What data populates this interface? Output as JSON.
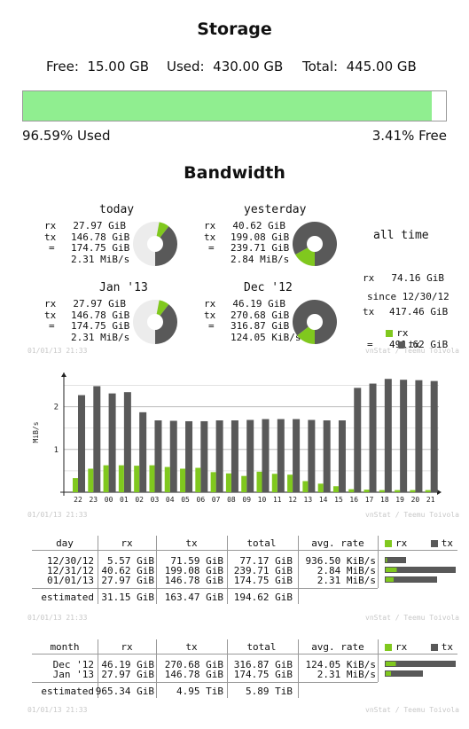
{
  "storage": {
    "title": "Storage",
    "free_label": "Free:",
    "free_value": "15.00 GB",
    "used_label": "Used:",
    "used_value": "430.00 GB",
    "total_label": "Total:",
    "total_value": "445.00 GB",
    "used_percent_text": "96.59% Used",
    "free_percent_text": "3.41% Free",
    "used_fraction": 0.9659
  },
  "bandwidth": {
    "title": "Bandwidth",
    "colors": {
      "rx": "#80c81e",
      "tx": "#595959",
      "bg": "#ececec"
    },
    "summaries": [
      {
        "title": "today",
        "rx": "27.97 GiB",
        "tx": "146.78 GiB",
        "total": "174.75 GiB",
        "rate": "2.31 MiB/s",
        "rx_frac": 0.0753,
        "tx_frac": 0.395
      },
      {
        "title": "yesterday",
        "rx": "40.62 GiB",
        "tx": "199.08 GiB",
        "total": "239.71 GiB",
        "rate": "2.84 MiB/s",
        "rx_frac": 0.17,
        "tx_frac": 0.83
      },
      {
        "title": "Jan '13",
        "rx": "27.97 GiB",
        "tx": "146.78 GiB",
        "total": "174.75 GiB",
        "rate": "2.31 MiB/s",
        "rx_frac": 0.0753,
        "tx_frac": 0.395
      },
      {
        "title": "Dec '12",
        "rx": "46.19 GiB",
        "tx": "270.68 GiB",
        "total": "316.87 GiB",
        "rate": "124.05 KiB/s",
        "rx_frac": 0.146,
        "tx_frac": 0.854
      }
    ],
    "labels": {
      "rx": "rx",
      "tx": "tx",
      "eq": "="
    },
    "all_time": {
      "title": "all time",
      "rx": "74.16 GiB",
      "tx": "417.46 GiB",
      "total": "491.62 GiB",
      "since": "since 12/30/12"
    },
    "stamp": "01/01/13 21:33",
    "credit": "vnStat / Teemu Toivola",
    "chart_data": {
      "type": "bar",
      "ylabel": "MiB/s",
      "ylim": [
        0,
        2.8
      ],
      "yticks": [
        "1",
        "2"
      ],
      "categories": [
        "22",
        "23",
        "00",
        "01",
        "02",
        "03",
        "04",
        "05",
        "06",
        "07",
        "08",
        "09",
        "10",
        "11",
        "12",
        "13",
        "14",
        "15",
        "16",
        "17",
        "18",
        "19",
        "20",
        "21"
      ],
      "series": [
        {
          "name": "tx",
          "values": [
            2.27,
            2.48,
            2.31,
            2.34,
            1.87,
            1.68,
            1.67,
            1.66,
            1.66,
            1.68,
            1.68,
            1.69,
            1.71,
            1.71,
            1.71,
            1.69,
            1.68,
            1.68,
            2.44,
            2.54,
            2.65,
            2.63,
            2.62,
            2.6
          ]
        },
        {
          "name": "rx",
          "values": [
            0.33,
            0.55,
            0.63,
            0.63,
            0.62,
            0.63,
            0.59,
            0.55,
            0.57,
            0.47,
            0.44,
            0.38,
            0.48,
            0.43,
            0.41,
            0.26,
            0.2,
            0.14,
            0.07,
            0.06,
            0.05,
            0.05,
            0.05,
            0.05
          ]
        }
      ]
    },
    "daily_table": {
      "headers": [
        "day",
        "rx",
        "tx",
        "total",
        "avg. rate"
      ],
      "rows": [
        {
          "label": "12/30/12",
          "rx": "5.57 GiB",
          "tx": "71.59 GiB",
          "total": "77.17 GiB",
          "rate": "936.50 KiB/s",
          "rx_frac": 0.022,
          "tx_frac": 0.28
        },
        {
          "label": "12/31/12",
          "rx": "40.62 GiB",
          "tx": "199.08 GiB",
          "total": "239.71 GiB",
          "rate": "2.84 MiB/s",
          "rx_frac": 0.16,
          "tx_frac": 0.84
        },
        {
          "label": "01/01/13",
          "rx": "27.97 GiB",
          "tx": "146.78 GiB",
          "total": "174.75 GiB",
          "rate": "2.31 MiB/s",
          "rx_frac": 0.12,
          "tx_frac": 0.62
        }
      ],
      "estimated": {
        "label": "estimated",
        "rx": "31.15 GiB",
        "tx": "163.47 GiB",
        "total": "194.62 GiB"
      }
    },
    "monthly_table": {
      "headers": [
        "month",
        "rx",
        "tx",
        "total",
        "avg. rate"
      ],
      "rows": [
        {
          "label": "Dec '12",
          "rx": "46.19 GiB",
          "tx": "270.68 GiB",
          "total": "316.87 GiB",
          "rate": "124.05 KiB/s",
          "rx_frac": 0.146,
          "tx_frac": 0.854
        },
        {
          "label": "Jan '13",
          "rx": "27.97 GiB",
          "tx": "146.78 GiB",
          "total": "174.75 GiB",
          "rate": "2.31 MiB/s",
          "rx_frac": 0.08,
          "tx_frac": 0.46
        }
      ],
      "estimated": {
        "label": "estimated",
        "rx": "965.34 GiB",
        "tx": "4.95 TiB",
        "total": "5.89 TiB"
      }
    }
  }
}
